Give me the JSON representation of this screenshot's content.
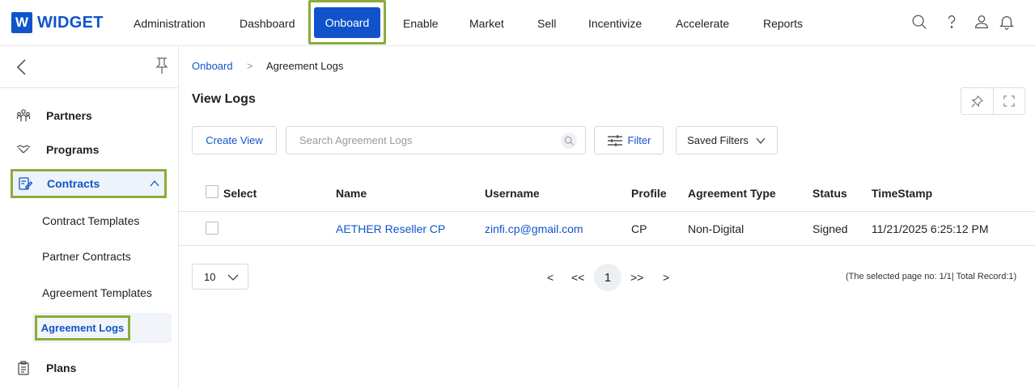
{
  "brand": {
    "logo_letter": "W",
    "name": "WIDGET"
  },
  "nav": {
    "items": [
      "Administration",
      "Dashboard",
      "Onboard",
      "Enable",
      "Market",
      "Sell",
      "Incentivize",
      "Accelerate",
      "Reports"
    ],
    "active": "Onboard"
  },
  "top_icons": [
    "search-icon",
    "help-icon",
    "user-icon",
    "bell-icon"
  ],
  "sidebar": {
    "items": [
      {
        "label": "Partners",
        "icon": "partners-icon"
      },
      {
        "label": "Programs",
        "icon": "handshake-icon"
      },
      {
        "label": "Contracts",
        "icon": "contract-icon",
        "expanded": true
      },
      {
        "label": "Plans",
        "icon": "clipboard-icon"
      }
    ],
    "sub_items": [
      "Contract Templates",
      "Partner Contracts",
      "Agreement Templates",
      "Agreement Logs"
    ],
    "active_sub": "Agreement Logs"
  },
  "breadcrumb": {
    "parent": "Onboard",
    "separator": ">",
    "current": "Agreement Logs"
  },
  "page": {
    "title": "View Logs"
  },
  "toolbar": {
    "create_view": "Create View",
    "search_placeholder": "Search Agreement Logs",
    "filter": "Filter",
    "saved_filters": "Saved Filters"
  },
  "table": {
    "columns": [
      "Select",
      "Name",
      "Username",
      "Profile",
      "Agreement Type",
      "Status",
      "TimeStamp"
    ],
    "rows": [
      {
        "name": "AETHER Reseller CP",
        "username": "zinfi.cp@gmail.com",
        "profile": "CP",
        "agreement_type": "Non-Digital",
        "status": "Signed",
        "timestamp": "11/21/2025 6:25:12 PM"
      }
    ]
  },
  "pagination": {
    "page_size": "10",
    "prev": "<",
    "first": "<<",
    "current": "1",
    "last": ">>",
    "next": ">",
    "info": "(The selected page no: 1/1| Total Record:1)"
  },
  "colors": {
    "brand": "#1154c9",
    "highlight_border": "#8aac3c",
    "active_nav_bg": "#0f52cc"
  }
}
